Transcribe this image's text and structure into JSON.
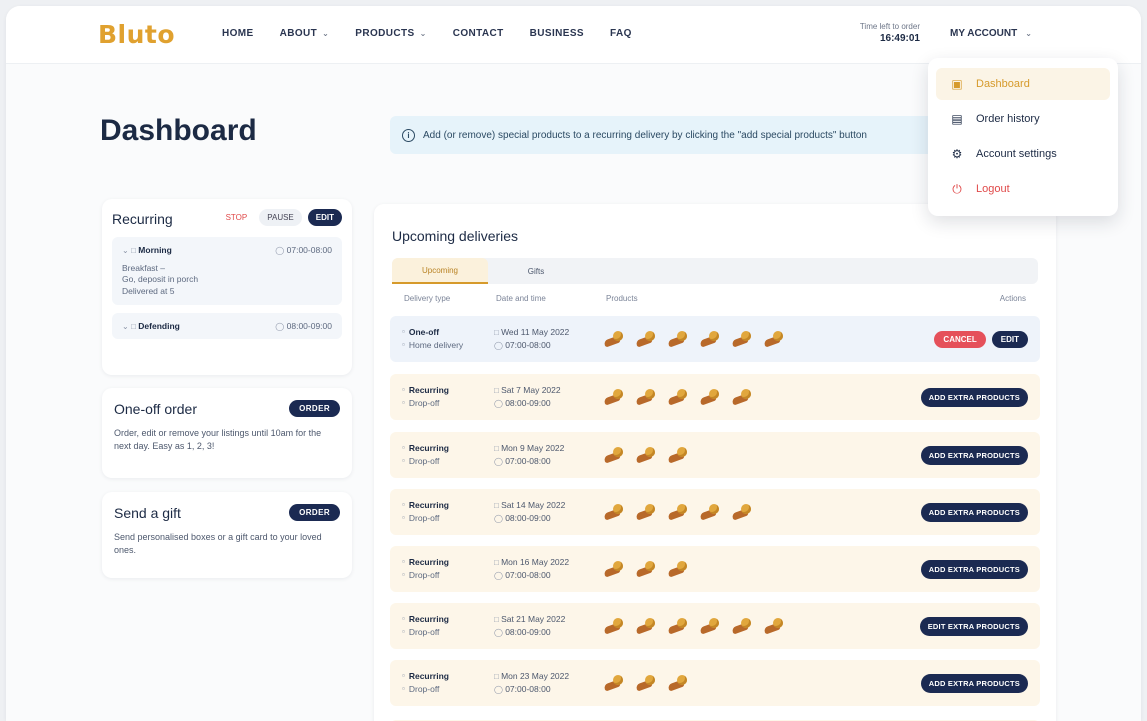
{
  "brand": "Bluto",
  "nav": [
    {
      "label": "HOME",
      "has_menu": false
    },
    {
      "label": "ABOUT",
      "has_menu": true
    },
    {
      "label": "PRODUCTS",
      "has_menu": true
    },
    {
      "label": "CONTACT",
      "has_menu": false
    },
    {
      "label": "BUSINESS",
      "has_menu": false
    },
    {
      "label": "FAQ",
      "has_menu": false
    }
  ],
  "order_info": {
    "line1": "Time left to order",
    "line2": "16:49:01"
  },
  "account": {
    "label": "MY ACCOUNT"
  },
  "dropdown": [
    {
      "label": "Dashboard",
      "icon": "dashboard-icon",
      "active": true
    },
    {
      "label": "Order history",
      "icon": "document-icon",
      "active": false
    },
    {
      "label": "Account settings",
      "icon": "gear-icon",
      "active": false
    },
    {
      "label": "Logout",
      "icon": "power-icon",
      "active": false
    }
  ],
  "page_title": "Dashboard",
  "info_banner": "Add (or remove) special products to a recurring delivery by clicking the \"add special products\" button",
  "recurring": {
    "title": "Recurring",
    "pause": "STOP",
    "edit_light": "PAUSE",
    "edit_dark": "EDIT",
    "slot1": {
      "name": "Morning",
      "time": "07:00-08:00",
      "note": "Breakfast –\nGo, deposit in porch\nDelivered at 5"
    },
    "slot2": {
      "name": "Defending",
      "time": "08:00-09:00"
    }
  },
  "one_off": {
    "title": "One-off order",
    "button": "ORDER",
    "desc": "Order, edit or remove your listings until 10am for the next day. Easy as 1, 2, 3!"
  },
  "gift": {
    "title": "Send a gift",
    "button": "ORDER",
    "desc": "Send personalised boxes or a gift card to your loved ones."
  },
  "deliveries": {
    "title": "Upcoming deliveries",
    "tabs": [
      "Upcoming",
      "Gifts"
    ],
    "headers": [
      "Delivery type",
      "Date and time",
      "Products",
      "Actions"
    ],
    "rows": [
      {
        "type": "One-off",
        "sub": "Home delivery",
        "date": "Wed 11 May 2022",
        "time": "07:00-08:00",
        "products": 6,
        "style": "blue",
        "actions": [
          "CANCEL",
          "EDIT"
        ]
      },
      {
        "type": "Recurring",
        "sub": "Drop-off",
        "date": "Sat 7 May 2022",
        "time": "08:00-09:00",
        "products": 5,
        "style": "cream",
        "actions": [
          "ADD EXTRA PRODUCTS"
        ]
      },
      {
        "type": "Recurring",
        "sub": "Drop-off",
        "date": "Mon 9 May 2022",
        "time": "07:00-08:00",
        "products": 3,
        "style": "cream",
        "actions": [
          "ADD EXTRA PRODUCTS"
        ]
      },
      {
        "type": "Recurring",
        "sub": "Drop-off",
        "date": "Sat 14 May 2022",
        "time": "08:00-09:00",
        "products": 5,
        "style": "cream",
        "actions": [
          "ADD EXTRA PRODUCTS"
        ]
      },
      {
        "type": "Recurring",
        "sub": "Drop-off",
        "date": "Mon 16 May 2022",
        "time": "07:00-08:00",
        "products": 3,
        "style": "cream",
        "actions": [
          "ADD EXTRA PRODUCTS"
        ]
      },
      {
        "type": "Recurring",
        "sub": "Drop-off",
        "date": "Sat 21 May 2022",
        "time": "08:00-09:00",
        "products": 6,
        "style": "cream",
        "actions": [
          "EDIT EXTRA PRODUCTS"
        ]
      },
      {
        "type": "Recurring",
        "sub": "Drop-off",
        "date": "Mon 23 May 2022",
        "time": "07:00-08:00",
        "products": 3,
        "style": "cream",
        "actions": [
          "ADD EXTRA PRODUCTS"
        ]
      }
    ]
  },
  "colors": {
    "brand": "#e0a12f",
    "navy": "#1b2a52",
    "danger": "#e5505a"
  }
}
